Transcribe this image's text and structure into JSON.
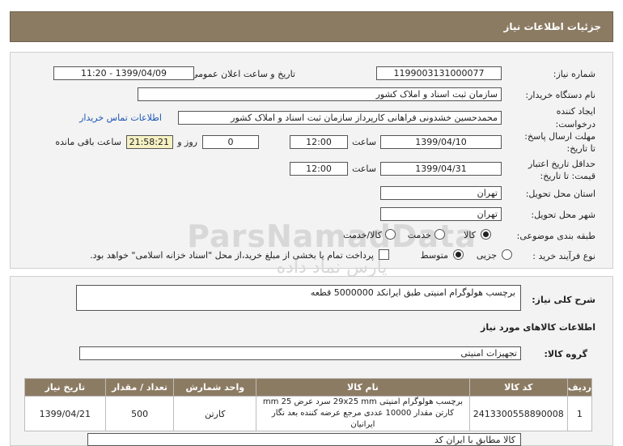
{
  "header": {
    "title": "جزئیات اطلاعات نیاز"
  },
  "form": {
    "need_number_label": "شماره نیاز:",
    "need_number": "1199003131000077",
    "announce_label": "تاریخ و ساعت اعلان عمومی:",
    "announce_value": "1399/04/09 - 11:20",
    "buyer_org_label": "نام دستگاه خریدار:",
    "buyer_org": "سازمان ثبت اسناد و املاک کشور",
    "creator_label_1": "ایجاد کننده",
    "creator_label_2": "درخواست:",
    "creator": "محمدحسین خشدونی فراهانی کارپرداز سازمان ثبت اسناد و املاک کشور",
    "contact_link": "اطلاعات تماس خریدار",
    "deadline_label_1": "مهلت ارسال پاسخ:",
    "deadline_label_2": "تا تاریخ:",
    "deadline_date": "1399/04/10",
    "time_label": "ساعت",
    "deadline_time": "12:00",
    "days_value": "0",
    "days_label": "روز و",
    "remaining_time": "21:58:21",
    "remaining_label": "ساعت باقی مانده",
    "validity_label_1": "حداقل تاریخ اعتبار",
    "validity_label_2": "قیمت: تا تاریخ:",
    "validity_date": "1399/04/31",
    "validity_time_label": "ساعت",
    "validity_time": "12:00",
    "province_label": "استان محل تحویل:",
    "province": "تهران",
    "city_label": "شهر محل تحویل:",
    "city": "تهران",
    "category_label": "طبقه بندی موضوعی:",
    "category_options": [
      "کالا",
      "خدمت",
      "کالا/خدمت"
    ],
    "category_selected": "کالا",
    "process_label": "نوع فرآیند خرید :",
    "process_options": [
      "جزیی",
      "متوسط"
    ],
    "process_selected": "متوسط",
    "payment_note": "پرداخت تمام یا بخشی از مبلغ خرید،از محل \"اسناد خزانه اسلامی\" خواهد بود."
  },
  "section2": {
    "description_label": "شرح کلی نیاز:",
    "description": "برچسب هولوگرام امنیتی طبق ایرانکد 5000000 قطعه",
    "goods_info_title": "اطلاعات کالاهای مورد نیاز",
    "goods_group_label": "گروه کالا:",
    "goods_group": "تجهیزات امنیتی",
    "table": {
      "headers": [
        "ردیف",
        "کد کالا",
        "نام کالا",
        "واحد شمارش",
        "تعداد / مقدار",
        "تاریخ نیاز"
      ],
      "rows": [
        {
          "row": "1",
          "code": "2413300558890008",
          "name_line1": "برچسب هولوگرام امنیتی 29x25 mm سرد عرض 25 mm",
          "name_line2": "کارتن مقدار 10000 عددی مرجع عرضه کننده بعد نگار ایرانیان",
          "unit": "کارتن",
          "qty": "500",
          "date": "1399/04/21"
        }
      ]
    },
    "buyer_notes_partial": "کالا مطابق با ایران کد"
  },
  "watermark": {
    "line1": "ParsNamadData",
    "line2": "پارس نماد داده",
    "line3": "پایگاه اطلاع رسانی مناقصه و مزایده",
    "line4": "۰۲۱-۸۸۳۴۹۶۷۰-۵"
  }
}
